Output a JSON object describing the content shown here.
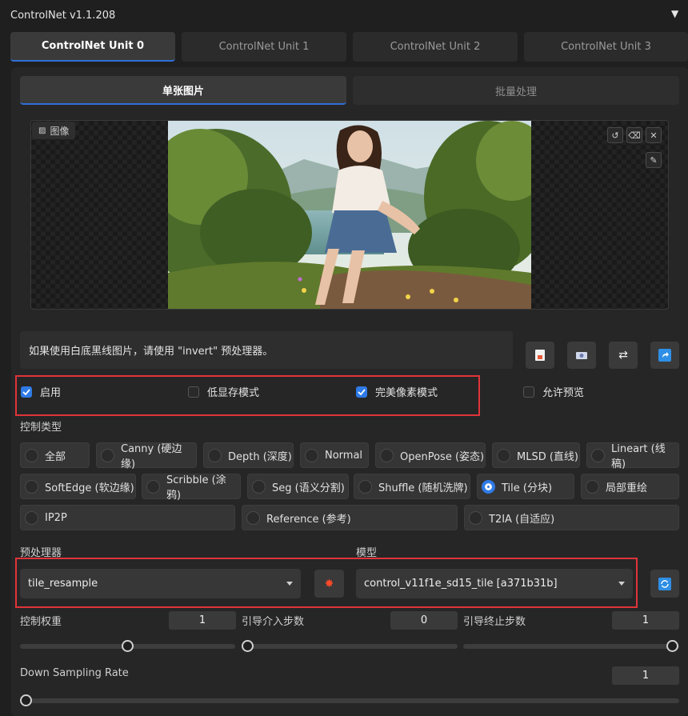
{
  "header": {
    "title": "ControlNet v1.1.208"
  },
  "unit_tabs": [
    "ControlNet Unit 0",
    "ControlNet Unit 1",
    "ControlNet Unit 2",
    "ControlNet Unit 3"
  ],
  "mode_tabs": [
    "单张图片",
    "批量处理"
  ],
  "image": {
    "label": "图像"
  },
  "info_text": "如果使用白底黑线图片，请使用 \"invert\" 预处理器。",
  "checkboxes": {
    "enable": {
      "label": "启用",
      "checked": true
    },
    "lowvram": {
      "label": "低显存模式",
      "checked": false
    },
    "pixel_perfect": {
      "label": "完美像素模式",
      "checked": true
    },
    "allow_preview": {
      "label": "允许预览",
      "checked": false
    }
  },
  "control_type": {
    "label": "控制类型",
    "options": [
      "全部",
      "Canny (硬边缘)",
      "Depth (深度)",
      "Normal",
      "OpenPose (姿态)",
      "MLSD (直线)",
      "Lineart (线稿)",
      "SoftEdge (软边缘)",
      "Scribble (涂鸦)",
      "Seg (语义分割)",
      "Shuffle (随机洗牌)",
      "Tile (分块)",
      "局部重绘",
      "IP2P",
      "Reference (参考)",
      "T2IA (自适应)"
    ],
    "selected": "Tile (分块)"
  },
  "preprocessor": {
    "label": "预处理器",
    "value": "tile_resample"
  },
  "model": {
    "label": "模型",
    "value": "control_v11f1e_sd15_tile [a371b31b]"
  },
  "sliders": {
    "weight": {
      "label": "控制权重",
      "value": "1"
    },
    "start": {
      "label": "引导介入步数",
      "value": "0"
    },
    "end": {
      "label": "引导终止步数",
      "value": "1"
    },
    "down_sampling": {
      "label": "Down Sampling Rate",
      "value": "1"
    }
  },
  "colors": {
    "accent": "#2f7be6",
    "highlight_border": "#e0343a"
  }
}
